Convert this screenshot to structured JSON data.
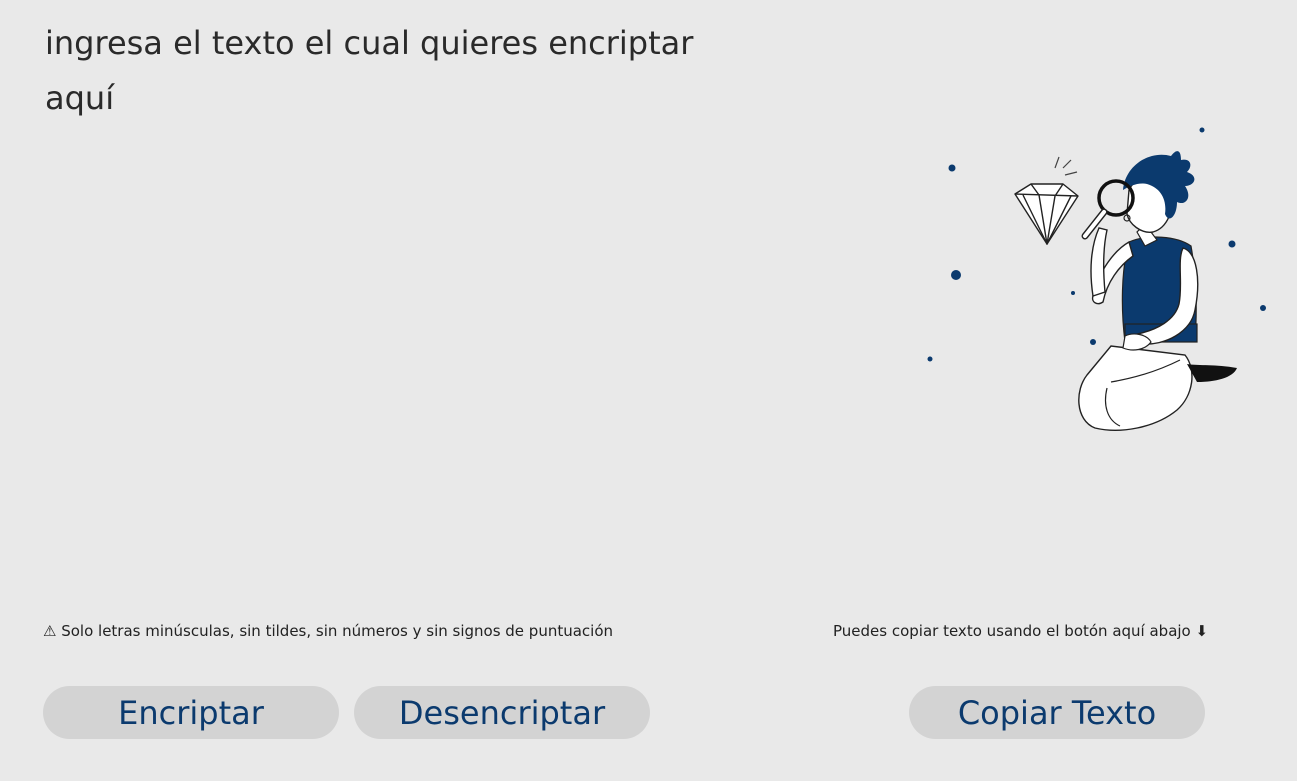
{
  "input": {
    "placeholder": "ingresa el texto el cual quieres encriptar aquí"
  },
  "hints": {
    "left_icon": "⚠",
    "left": " Solo letras minúsculas, sin tildes, sin números y sin signos de puntuación",
    "right": "Puedes copiar texto usando el botón aquí abajo",
    "right_icon": " ⬇"
  },
  "buttons": {
    "encrypt": "Encriptar",
    "decrypt": "Desencriptar",
    "copy": "Copiar Texto"
  },
  "colors": {
    "background": "#e9e9e9",
    "button_bg": "#d3d3d3",
    "accent": "#0b3a6e"
  },
  "illustration": {
    "icon": "person-with-magnifier-illustration"
  }
}
